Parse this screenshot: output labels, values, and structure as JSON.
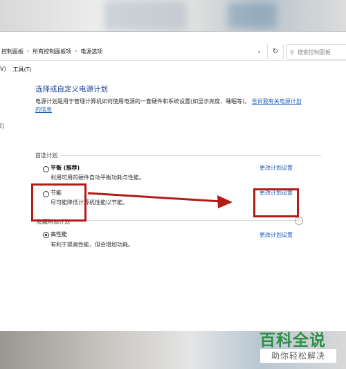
{
  "breadcrumb": [
    "控制面板",
    "所有控制面板项",
    "电源选项"
  ],
  "search": {
    "placeholder": "搜索控制面板"
  },
  "menu": [
    "V)",
    "工具(T)"
  ],
  "side_mark": "[|",
  "page": {
    "title": "选择或自定义电源计划",
    "description": "电源计划是用于管理计算机如何使用电源的一套硬件和系统设置(如显示亮度、睡眠等)。",
    "description_link": "告诉我有关电源计划的信息"
  },
  "sections": {
    "preferred": "首选计划",
    "hidden": "隐藏附加计划"
  },
  "plans": [
    {
      "name": "平衡 (推荐)",
      "desc": "利用可用的硬件自动平衡功耗与性能。",
      "link": "更改计划设置",
      "selected": false
    },
    {
      "name": "节能",
      "desc": "尽可能降低计算机性能以节能。",
      "link": "更改计划设置",
      "selected": false
    },
    {
      "name": "高性能",
      "desc": "有利于提高性能，但会增加功耗。",
      "link": "更改计划设置",
      "selected": true
    }
  ],
  "watermark": {
    "main": "百科全说",
    "sub": "助你轻松解决"
  },
  "colors": {
    "annotation": "#b31b17",
    "link": "#1f5fb8",
    "title": "#1c3f95",
    "logo": "#2d8f45"
  }
}
